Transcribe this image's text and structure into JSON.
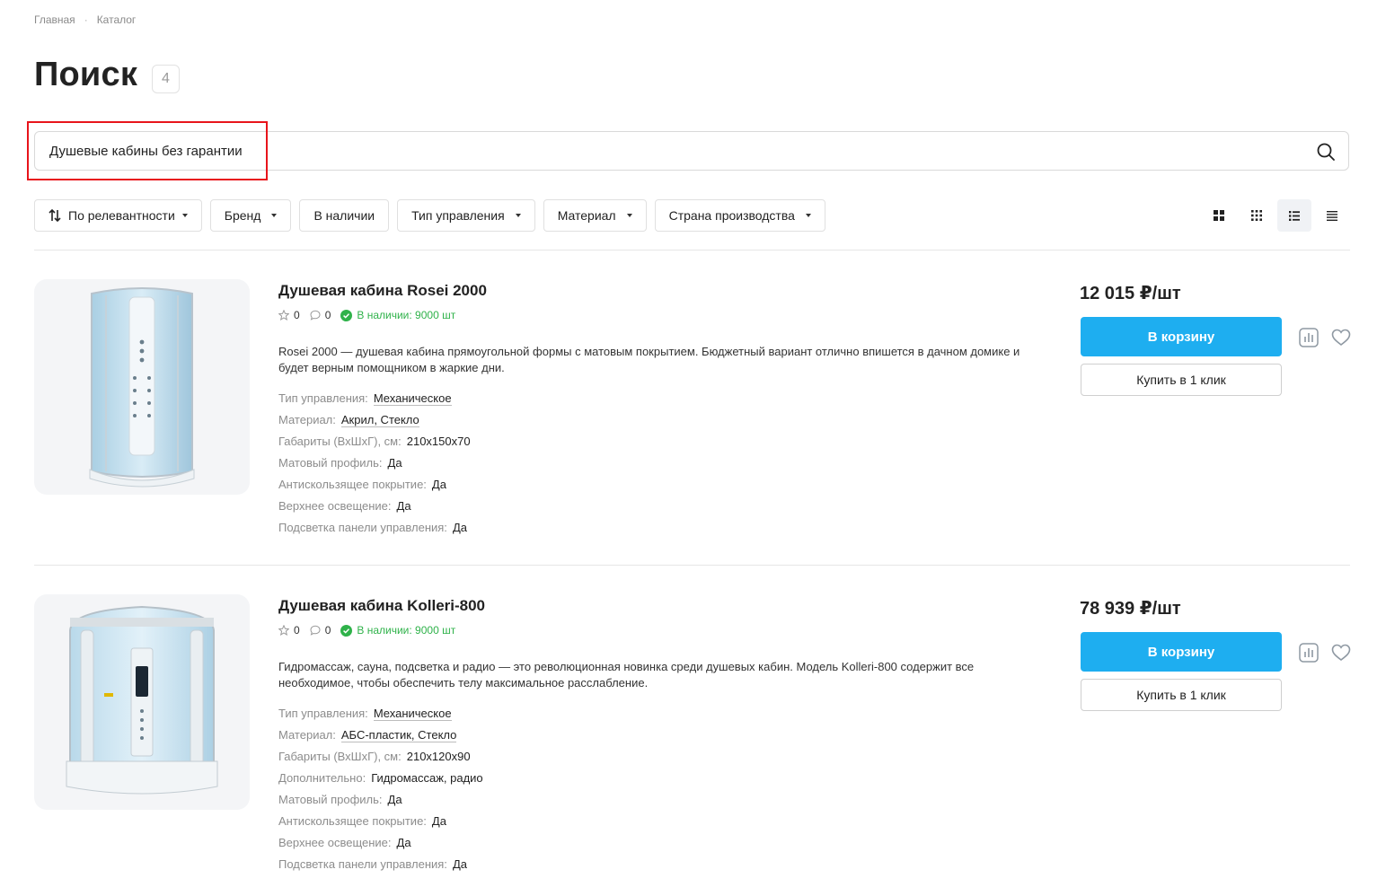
{
  "breadcrumb": {
    "items": [
      "Главная",
      "Каталог"
    ],
    "separator": "·"
  },
  "page": {
    "title": "Поиск",
    "count": "4"
  },
  "search": {
    "value": "Душевые кабины без гарантии",
    "placeholder": ""
  },
  "filters": {
    "sort": "По релевантности",
    "brand": "Бренд",
    "in_stock": "В наличии",
    "control_type": "Тип управления",
    "material": "Материал",
    "country": "Страна производства"
  },
  "view_modes": [
    "grid-large-icon",
    "grid-small-icon",
    "list-icon",
    "table-icon"
  ],
  "colors": {
    "accent": "#1eaef0",
    "stock": "#2fb24a",
    "highlight": "#e8141b"
  },
  "products": [
    {
      "name": "Душевая кабина Rosei 2000",
      "rating": "0",
      "reviews": "0",
      "stock": "В наличии: 9000 шт",
      "description": "Rosei 2000 — душевая кабина прямоугольной формы с матовым покрытием. Бюджетный вариант отлично впишется в дачном домике и будет верным помощником в жаркие дни.",
      "props": [
        {
          "label": "Тип управления:",
          "value": "Механическое"
        },
        {
          "label": "Материал:",
          "value": "Акрил, Стекло"
        },
        {
          "label": "Габариты (ВхШхГ), см:",
          "value": "210x150x70"
        },
        {
          "label": "Матовый профиль:",
          "value": "Да"
        },
        {
          "label": "Антискользящее покрытие:",
          "value": "Да"
        },
        {
          "label": "Верхнее освещение:",
          "value": "Да"
        },
        {
          "label": "Подсветка панели управления:",
          "value": "Да"
        }
      ],
      "price": "12 015 ₽/шт",
      "cart_label": "В корзину",
      "one_click_label": "Купить в 1 клик"
    },
    {
      "name": "Душевая кабина Kolleri-800",
      "rating": "0",
      "reviews": "0",
      "stock": "В наличии: 9000 шт",
      "description": "Гидромассаж, сауна, подсветка и радио — это революционная новинка среди душевых кабин. Модель Kolleri-800 содержит все необходимое, чтобы обеспечить телу максимальное расслабление.",
      "props": [
        {
          "label": "Тип управления:",
          "value": "Механическое"
        },
        {
          "label": "Материал:",
          "value": "АБС-пластик, Стекло"
        },
        {
          "label": "Габариты (ВхШхГ), см:",
          "value": "210x120x90"
        },
        {
          "label": "Дополнительно:",
          "value": "Гидромассаж, радио"
        },
        {
          "label": "Матовый профиль:",
          "value": "Да"
        },
        {
          "label": "Антискользящее покрытие:",
          "value": "Да"
        },
        {
          "label": "Верхнее освещение:",
          "value": "Да"
        },
        {
          "label": "Подсветка панели управления:",
          "value": "Да"
        }
      ],
      "price": "78 939 ₽/шт",
      "cart_label": "В корзину",
      "one_click_label": "Купить в 1 клик"
    }
  ]
}
